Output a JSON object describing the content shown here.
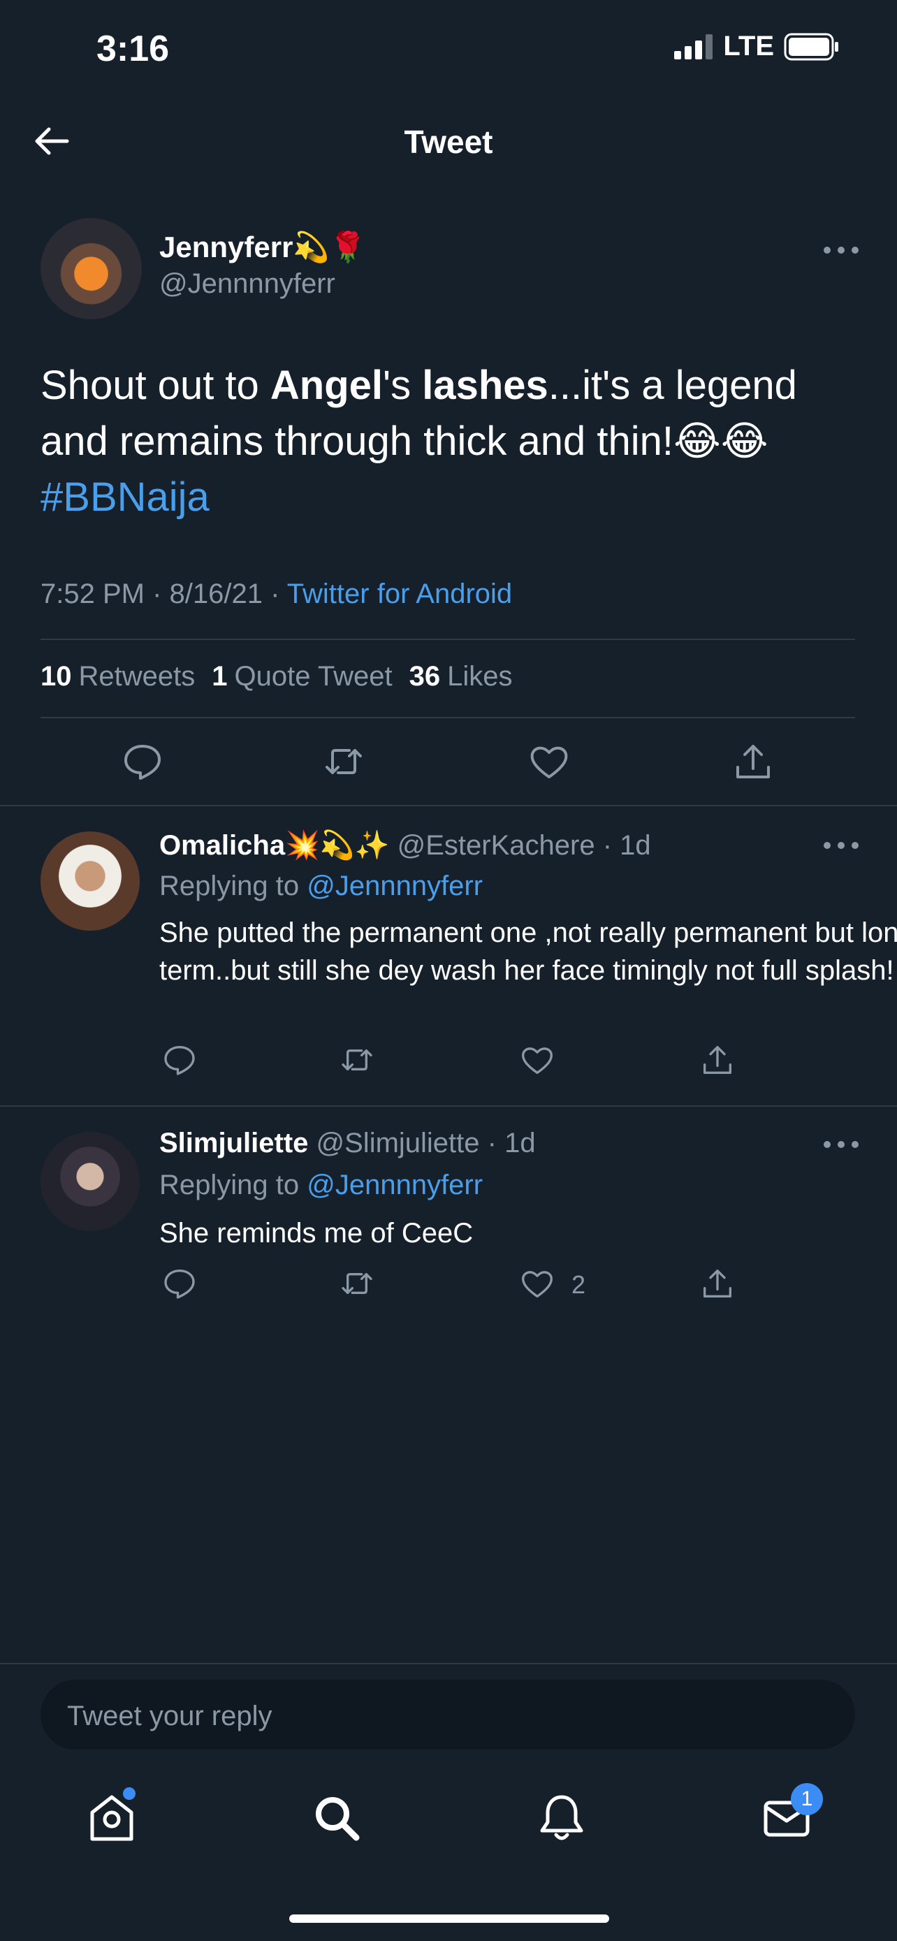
{
  "status_bar": {
    "time": "3:16",
    "network": "LTE"
  },
  "nav": {
    "title": "Tweet"
  },
  "tweet": {
    "author_name": "Jennyferr",
    "author_emoji": "💫🌹",
    "handle": "@Jennnnyferr",
    "text_parts": [
      "Shout out to ",
      "Angel",
      "'s ",
      "lashes",
      "...it's a legend and remains through thick and thin!😂😂 "
    ],
    "hashtag": "#BBNaija",
    "time": "7:52 PM · 8/16/21 · ",
    "source": "Twitter for Android",
    "stats": {
      "retweets_count": "10",
      "retweets_label": "Retweets",
      "quotes_count": "1",
      "quotes_label": "Quote Tweet",
      "likes_count": "36",
      "likes_label": "Likes"
    }
  },
  "replies": [
    {
      "name": "Omalicha",
      "emoji": "💥💫✨",
      "handle_time": "@EsterKachere · 1d",
      "replying_prefix": "Replying to ",
      "replying_handle": "@Jennnnyferr",
      "text": "She putted the permanent one ,not really permanent but long term..but still she dey wash her face timingly not full splash!",
      "like_count": ""
    },
    {
      "name": "Slimjuliette",
      "emoji": "",
      "handle_time": "@Slimjuliette · 1d",
      "replying_prefix": "Replying to ",
      "replying_handle": "@Jennnnyferr",
      "text": "She reminds me of CeeC",
      "like_count": "2"
    }
  ],
  "composer": {
    "placeholder": "Tweet your reply"
  },
  "tabbar": {
    "messages_badge": "1"
  },
  "colors": {
    "background": "#16202b",
    "accent": "#4a9eea",
    "muted": "#8b98a5"
  },
  "icons": [
    "back-arrow-icon",
    "more-icon",
    "reply-icon",
    "retweet-icon",
    "like-icon",
    "share-icon",
    "home-icon",
    "search-icon",
    "bell-icon",
    "mail-icon"
  ]
}
